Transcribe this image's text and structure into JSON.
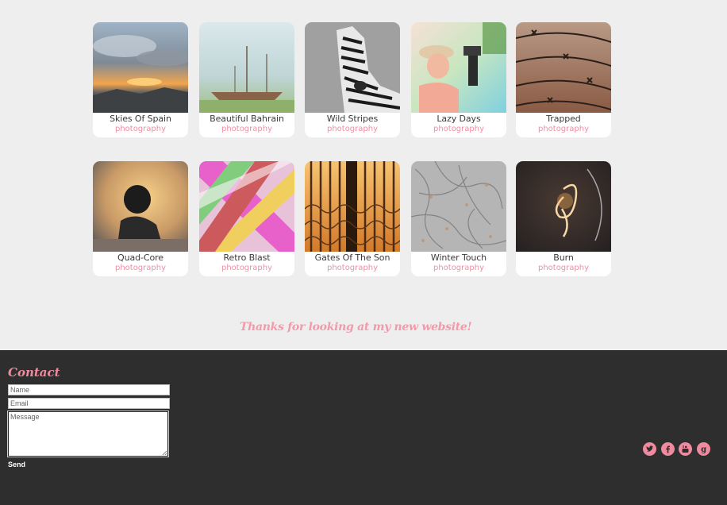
{
  "gallery": {
    "items": [
      {
        "title": "Skies Of Spain",
        "category": "photography"
      },
      {
        "title": "Beautiful Bahrain",
        "category": "photography"
      },
      {
        "title": "Wild Stripes",
        "category": "photography"
      },
      {
        "title": "Lazy Days",
        "category": "photography"
      },
      {
        "title": "Trapped",
        "category": "photography"
      },
      {
        "title": "Quad-Core",
        "category": "photography"
      },
      {
        "title": "Retro Blast",
        "category": "photography"
      },
      {
        "title": "Gates Of The Son",
        "category": "photography"
      },
      {
        "title": "Winter Touch",
        "category": "photography"
      },
      {
        "title": "Burn",
        "category": "photography"
      }
    ]
  },
  "thanks_message": "Thanks for looking at my new website!",
  "footer": {
    "contact_title": "Contact",
    "name_placeholder": "Name",
    "email_placeholder": "Email",
    "message_placeholder": "Message",
    "send_label": "Send",
    "social_icons": [
      "twitter-icon",
      "facebook-icon",
      "youtube-icon",
      "google-plus-icon"
    ]
  },
  "colors": {
    "accent_pink": "#f08a9e",
    "footer_bg": "#2e2e2e",
    "page_bg": "#eeeeee"
  }
}
